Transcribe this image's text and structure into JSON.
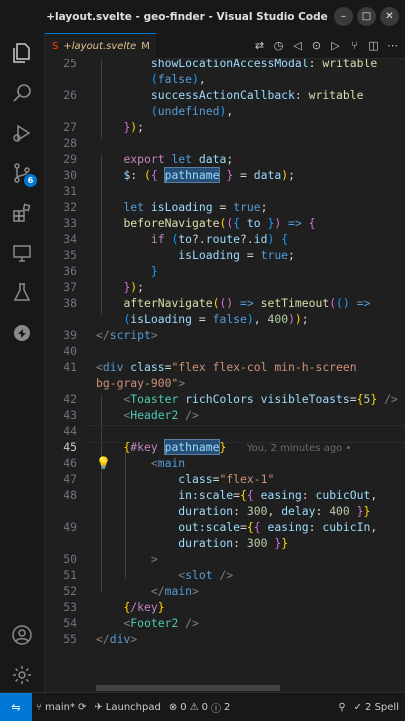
{
  "window": {
    "title": "+layout.svelte - geo-finder - Visual Studio Code"
  },
  "tab": {
    "name": "+layout.svelte",
    "status": "M"
  },
  "activity": {
    "scm_badge": "6"
  },
  "editor": {
    "blame": "You, 2 minutes ago •",
    "lines": {
      "n25": "25",
      "n26": "26",
      "n27": "27",
      "n28": "28",
      "n29": "29",
      "n30": "30",
      "n31": "31",
      "n32": "32",
      "n33": "33",
      "n34": "34",
      "n35": "35",
      "n36": "36",
      "n37": "37",
      "n38": "38",
      "n39": "39",
      "n40": "40",
      "n41": "41",
      "n42": "42",
      "n43": "43",
      "n44": "44",
      "n45": "45",
      "n46": "46",
      "n47": "47",
      "n48": "48",
      "n49": "49",
      "n50": "50",
      "n51": "51",
      "n52": "52",
      "n53": "53",
      "n54": "54",
      "n55": "55"
    }
  },
  "status": {
    "branch": "main*",
    "launchpad": "Launchpad",
    "errors": "0",
    "warnings": "0",
    "info": "2",
    "spell": "2 Spell"
  }
}
